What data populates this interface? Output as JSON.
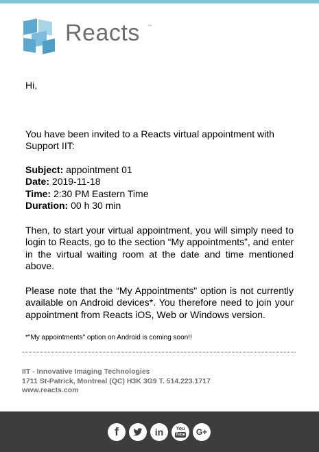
{
  "brand": {
    "name": "Reacts",
    "tm": "™"
  },
  "email": {
    "greeting": "Hi,",
    "invite": "You have been invited to a Reacts virtual appointment with Support IIT:",
    "subject_label": "Subject:",
    "subject_value": " appointment 01",
    "date_label": "Date:",
    "date_value": " 2019-11-18",
    "time_label": "Time:",
    "time_value": " 2:30 PM Eastern Time",
    "duration_label": "Duration:",
    "duration_value": " 00 h 30 min",
    "instructions": "Then, to start your virtual appointment, you will simply need to login to Reacts, go to the section “My appointments”, and enter in the virtual waiting room at the date and time mentioned above.",
    "note": "Please note that the “My Appointments\" option is not currently available on Android devices*. You therefore need to join your appointment from Reacts iOS, Web or Windows version.",
    "android_note": "*\"My appointments\" option on Android is coming soon!!"
  },
  "footer": {
    "company": "IIT - Innovative Imaging Technologies",
    "address": "1711 St-Patrick, Montreal (QC) H3K 3G9 T. 514.223.1717",
    "website": "www.reacts.com"
  },
  "social": {
    "facebook": "f",
    "youtube_top": "You",
    "youtube_bottom": "Tube",
    "googleplus": "G+",
    "linkedin": "in"
  },
  "icons": [
    "reacts-logo-icon",
    "facebook-icon",
    "twitter-icon",
    "linkedin-icon",
    "youtube-icon",
    "googleplus-icon"
  ],
  "colors": {
    "accent_bar": "#7ec6d6",
    "logo_blue": "#5ba8cc",
    "footer_bg": "#3d3d3d"
  }
}
